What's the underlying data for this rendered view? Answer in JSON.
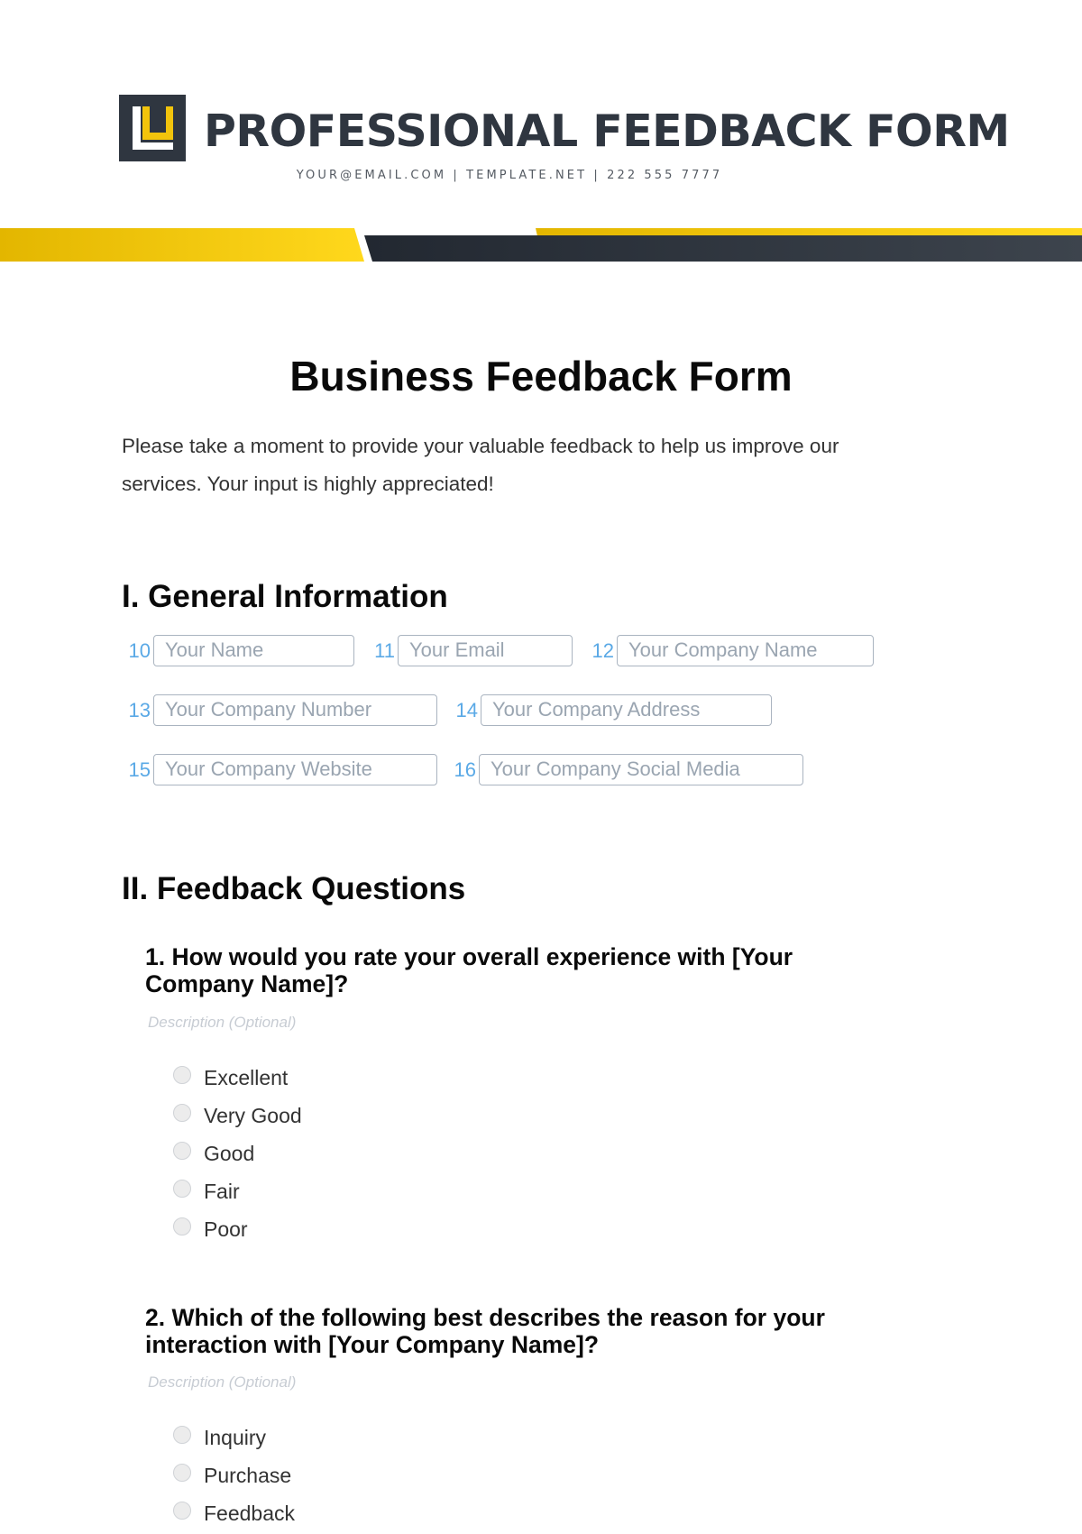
{
  "header": {
    "brand_title": "PROFESSIONAL FEEDBACK FORM",
    "contact_line": "YOUR@EMAIL.COM | TEMPLATE.NET | 222 555 7777",
    "logo_icon": "logo-icon",
    "colors": {
      "brand_dark": "#2f3640",
      "brand_yellow": "#f2c40c",
      "field_number": "#5aa9e6"
    }
  },
  "document": {
    "title": "Business Feedback Form",
    "intro_line1": "Please take a moment to provide your valuable feedback to help us improve our",
    "intro_line2": "services. Your input is highly appreciated!"
  },
  "general_information": {
    "heading": "I. General Information",
    "fields": [
      {
        "number": "10",
        "placeholder": "Your Name"
      },
      {
        "number": "11",
        "placeholder": "Your Email"
      },
      {
        "number": "12",
        "placeholder": "Your Company Name"
      },
      {
        "number": "13",
        "placeholder": "Your Company Number"
      },
      {
        "number": "14",
        "placeholder": "Your Company Address"
      },
      {
        "number": "15",
        "placeholder": "Your Company Website"
      },
      {
        "number": "16",
        "placeholder": "Your Company Social Media"
      }
    ]
  },
  "feedback_questions": {
    "heading": "II. Feedback Questions",
    "questions": [
      {
        "line1": "1. How would you rate your overall experience with [Your",
        "line2": "Company Name]?",
        "description_placeholder": "Description (Optional)",
        "options": [
          "Excellent",
          "Very Good",
          "Good",
          "Fair",
          "Poor"
        ]
      },
      {
        "line1": "2. Which of the following best describes the reason for your",
        "line2": "interaction with [Your Company Name]?",
        "description_placeholder": "Description (Optional)",
        "options": [
          "Inquiry",
          "Purchase",
          "Feedback"
        ]
      }
    ]
  }
}
